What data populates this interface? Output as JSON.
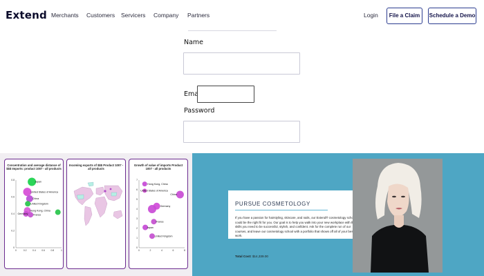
{
  "nav": {
    "logo": "Extend",
    "links": [
      "Merchants",
      "Customers",
      "Servicers",
      "Company",
      "Partners"
    ],
    "login": "Login",
    "file_claim": "File a Claim",
    "schedule_demo": "Schedule a Demo"
  },
  "form": {
    "name_label": "Name",
    "email_label": "Email",
    "password_label": "Password",
    "name_value": "",
    "email_value": "",
    "password_value": ""
  },
  "charts": {
    "card1_title": "Concentration and average distance of $$$ Imports: product 1007 - all products",
    "card2_title": "Incoming exports of $$$ Product 1007 - all products",
    "card3_title": "Growth of value of imports Product 1007 - all products",
    "card1_labels": [
      "Japan",
      "United States of America",
      "China",
      "United Kingdom",
      "Hong Kong, China",
      "Germany",
      "France"
    ],
    "card3_labels": [
      "Hong Kong, China",
      "United States of America",
      "Japan",
      "Germany",
      "China",
      "France",
      "United Kingdom"
    ],
    "card1_yticks": [
      "0.8",
      "0.6",
      "0.4",
      "0.2",
      "0"
    ],
    "card1_xticks": [
      "0",
      "0.2",
      "0.4",
      "0.6",
      "0.8",
      "1"
    ],
    "card3_yticks": [
      "7",
      "6",
      "5",
      "4",
      "3",
      "2",
      "1",
      "0"
    ],
    "card3_xticks": [
      "0",
      "2",
      "4",
      "6",
      "8"
    ]
  },
  "chart_data": [
    {
      "type": "scatter",
      "title": "Concentration and average distance of $$$ Imports: product 1007 - all products",
      "xlim": [
        0,
        1
      ],
      "ylim": [
        0,
        0.8
      ],
      "points": [
        {
          "label": "Japan",
          "x": 0.35,
          "y": 0.78
        },
        {
          "label": "United States of America",
          "x": 0.25,
          "y": 0.66
        },
        {
          "label": "China",
          "x": 0.3,
          "y": 0.58
        },
        {
          "label": "United Kingdom",
          "x": 0.26,
          "y": 0.52
        },
        {
          "label": "Hong Kong, China",
          "x": 0.25,
          "y": 0.44
        },
        {
          "label": "Germany",
          "x": 0.22,
          "y": 0.4
        },
        {
          "label": "France",
          "x": 0.32,
          "y": 0.39
        },
        {
          "label": "",
          "x": 0.92,
          "y": 0.42
        }
      ]
    },
    {
      "type": "scatter",
      "title": "Growth of value of imports Product 1007 - all products",
      "xlim": [
        0,
        8
      ],
      "ylim": [
        0,
        7
      ],
      "points": [
        {
          "label": "Hong Kong, China",
          "x": 1.0,
          "y": 6.6
        },
        {
          "label": "United States of America",
          "x": 1.0,
          "y": 5.9
        },
        {
          "label": "China",
          "x": 7.2,
          "y": 5.5
        },
        {
          "label": "Germany",
          "x": 3.1,
          "y": 4.3
        },
        {
          "label": "",
          "x": 2.3,
          "y": 4.0
        },
        {
          "label": "France",
          "x": 2.6,
          "y": 2.7
        },
        {
          "label": "Japan",
          "x": 1.1,
          "y": 2.1
        },
        {
          "label": "United Kingdom",
          "x": 2.3,
          "y": 1.2
        }
      ]
    }
  ],
  "promo": {
    "title": "PURSUE COSMETOLOGY",
    "body": "If you have a passion for hairstyling, skincare, and nails, our Extend® cosmetology school could be the right fit for you. Our goal is to help you walk into your new workplace with the skills you need to be successful, stylish, and confident. Ask for the complete run of our courses, and leave our cosmetology school with a portfolio that shows off all of your best work.",
    "cost_label": "Total Cost:",
    "cost_value": "$14,339.00"
  }
}
